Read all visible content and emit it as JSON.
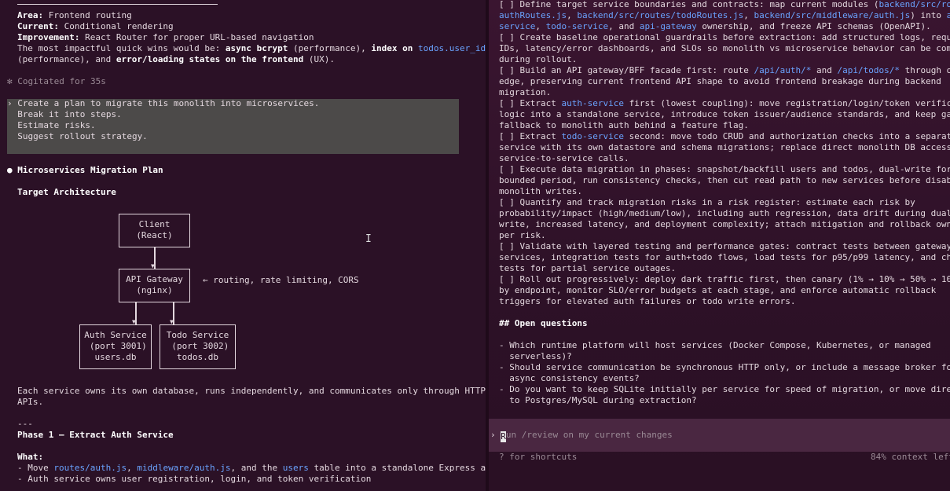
{
  "left": {
    "area_label": "Area:",
    "area_value": " Frontend routing",
    "current_label": "Current:",
    "current_value": " Conditional rendering",
    "improvement_label": "Improvement:",
    "improvement_value": " React Router for proper URL-based navigation",
    "impact_line1_a": "The most impactful quick wins would be: ",
    "impact_line1_b": "async bcrypt",
    "impact_line1_c": " (performance), ",
    "impact_line1_d": "index on ",
    "impact_line1_e": "todos.user_id",
    "impact_line2_a": "(performance), and ",
    "impact_line2_b": "error/loading states on the frontend",
    "impact_line2_c": " (UX).",
    "cogitated": "✻ Cogitated for 35s",
    "prompt_lines": [
      "› Create a plan to migrate this monolith into microservices.",
      "  Break it into steps.",
      "  Estimate risks.",
      "  Suggest rollout strategy."
    ],
    "plan_title": "Microservices Migration Plan",
    "target_arch": "Target Architecture",
    "diagram": {
      "client": "Client\n(React)",
      "gateway": "API Gateway\n(nginx)",
      "gateway_note": "← routing, rate limiting, CORS",
      "auth": "Auth Service\n (port 3001)\nusers.db",
      "todo": "Todo Service\n (port 3002)\ntodos.db"
    },
    "owns_line1": "Each service owns its own database, runs independently, and communicates only through HTTP",
    "owns_line2": "APIs.",
    "sep": "---",
    "phase1": "Phase 1 — Extract Auth Service",
    "what": "What:",
    "move_a": "- Move ",
    "move_b": "routes/auth.js",
    "move_c": ", ",
    "move_d": "middleware/auth.js",
    "move_e": ", and the ",
    "move_f": "users",
    "move_g": " table into a standalone Express app",
    "owns_auth": "- Auth service owns user registration, login, and token verification"
  },
  "right": {
    "lines": [
      [
        [
          "[ ] Define target service boundaries and contracts: map current modules (",
          ""
        ],
        [
          "backend/src/route",
          "c"
        ]
      ],
      [
        [
          "authRoutes.js",
          "c"
        ],
        [
          ", ",
          ""
        ],
        [
          "backend/src/routes/todoRoutes.js",
          "c"
        ],
        [
          ", ",
          ""
        ],
        [
          "backend/src/middleware/auth.js",
          "c"
        ],
        [
          ") into ",
          ""
        ],
        [
          "auth",
          "c"
        ]
      ],
      [
        [
          "service",
          "c"
        ],
        [
          ", ",
          ""
        ],
        [
          "todo-service",
          "c"
        ],
        [
          ", and ",
          ""
        ],
        [
          "api-gateway",
          "c"
        ],
        [
          " ownership, and freeze API schemas (OpenAPI).",
          ""
        ]
      ],
      [
        [
          "[ ] Create baseline operational guardrails before extraction: add structured logs, request",
          ""
        ]
      ],
      [
        [
          "IDs, latency/error dashboards, and SLOs so monolith vs microservice behavior can be compar",
          ""
        ]
      ],
      [
        [
          "during rollout.",
          ""
        ]
      ],
      [
        [
          "[ ] Build an API gateway/BFF facade first: route ",
          ""
        ],
        [
          "/api/auth/*",
          "c"
        ],
        [
          " and ",
          ""
        ],
        [
          "/api/todos/*",
          "c"
        ],
        [
          " through one",
          ""
        ]
      ],
      [
        [
          "edge, preserving current frontend API shape to avoid frontend breakage during backend",
          ""
        ]
      ],
      [
        [
          "migration.",
          ""
        ]
      ],
      [
        [
          "[ ] Extract ",
          ""
        ],
        [
          "auth-service",
          "c"
        ],
        [
          " first (lowest coupling): move registration/login/token verificati",
          ""
        ]
      ],
      [
        [
          "logic into a standalone service, introduce token issuer/audience standards, and keep gatew",
          ""
        ]
      ],
      [
        [
          "fallback to monolith auth behind a feature flag.",
          ""
        ]
      ],
      [
        [
          "[ ] Extract ",
          ""
        ],
        [
          "todo-service",
          "c"
        ],
        [
          " second: move todo CRUD and authorization checks into a separate",
          ""
        ]
      ],
      [
        [
          "service with its own datastore and schema migrations; replace direct monolith DB access wi",
          ""
        ]
      ],
      [
        [
          "service-to-service calls.",
          ""
        ]
      ],
      [
        [
          "[ ] Execute data migration in phases: snapshot/backfill users and todos, dual-write for a",
          ""
        ]
      ],
      [
        [
          "bounded period, run consistency checks, then cut read path to new services before disablin",
          ""
        ]
      ],
      [
        [
          "monolith writes.",
          ""
        ]
      ],
      [
        [
          "[ ] Quantify and track migration risks in a risk register: estimate each risk by",
          ""
        ]
      ],
      [
        [
          "probability/impact (high/medium/low), including auth regression, data drift during dual-",
          ""
        ]
      ],
      [
        [
          "write, increased latency, and deployment complexity; attach mitigation and rollback owner",
          ""
        ]
      ],
      [
        [
          "per risk.",
          ""
        ]
      ],
      [
        [
          "[ ] Validate with layered testing and performance gates: contract tests between gateway an",
          ""
        ]
      ],
      [
        [
          "services, integration tests for auth+todo flows, load tests for p95/p99 latency, and chaos",
          ""
        ]
      ],
      [
        [
          "tests for partial service outages.",
          ""
        ]
      ],
      [
        [
          "[ ] Roll out progressively: deploy dark traffic first, then canary (1% → 10% → 50% → 100%)",
          ""
        ]
      ],
      [
        [
          "by endpoint, monitor SLO/error budgets at each stage, and enforce automatic rollback",
          ""
        ]
      ],
      [
        [
          "triggers for elevated auth failures or todo write errors.",
          ""
        ]
      ],
      [
        [
          "",
          ""
        ]
      ],
      [
        [
          "## Open questions",
          "b"
        ]
      ],
      [
        [
          "",
          ""
        ]
      ],
      [
        [
          "- Which runtime platform will host services (Docker Compose, Kubernetes, or managed",
          ""
        ]
      ],
      [
        [
          "  serverless)?",
          ""
        ]
      ],
      [
        [
          "- Should service communication be synchronous HTTP only, or include a message broker for",
          ""
        ]
      ],
      [
        [
          "  async consistency events?",
          ""
        ]
      ],
      [
        [
          "- Do you want to keep SQLite initially per service for speed of migration, or move directl",
          ""
        ]
      ],
      [
        [
          "  to Postgres/MySQL during extraction?",
          ""
        ]
      ]
    ],
    "input_prefix": "›",
    "input_first_char": "R",
    "input_rest": "un /review on my current changes",
    "shortcuts": "? for shortcuts",
    "context": "84% context left"
  }
}
